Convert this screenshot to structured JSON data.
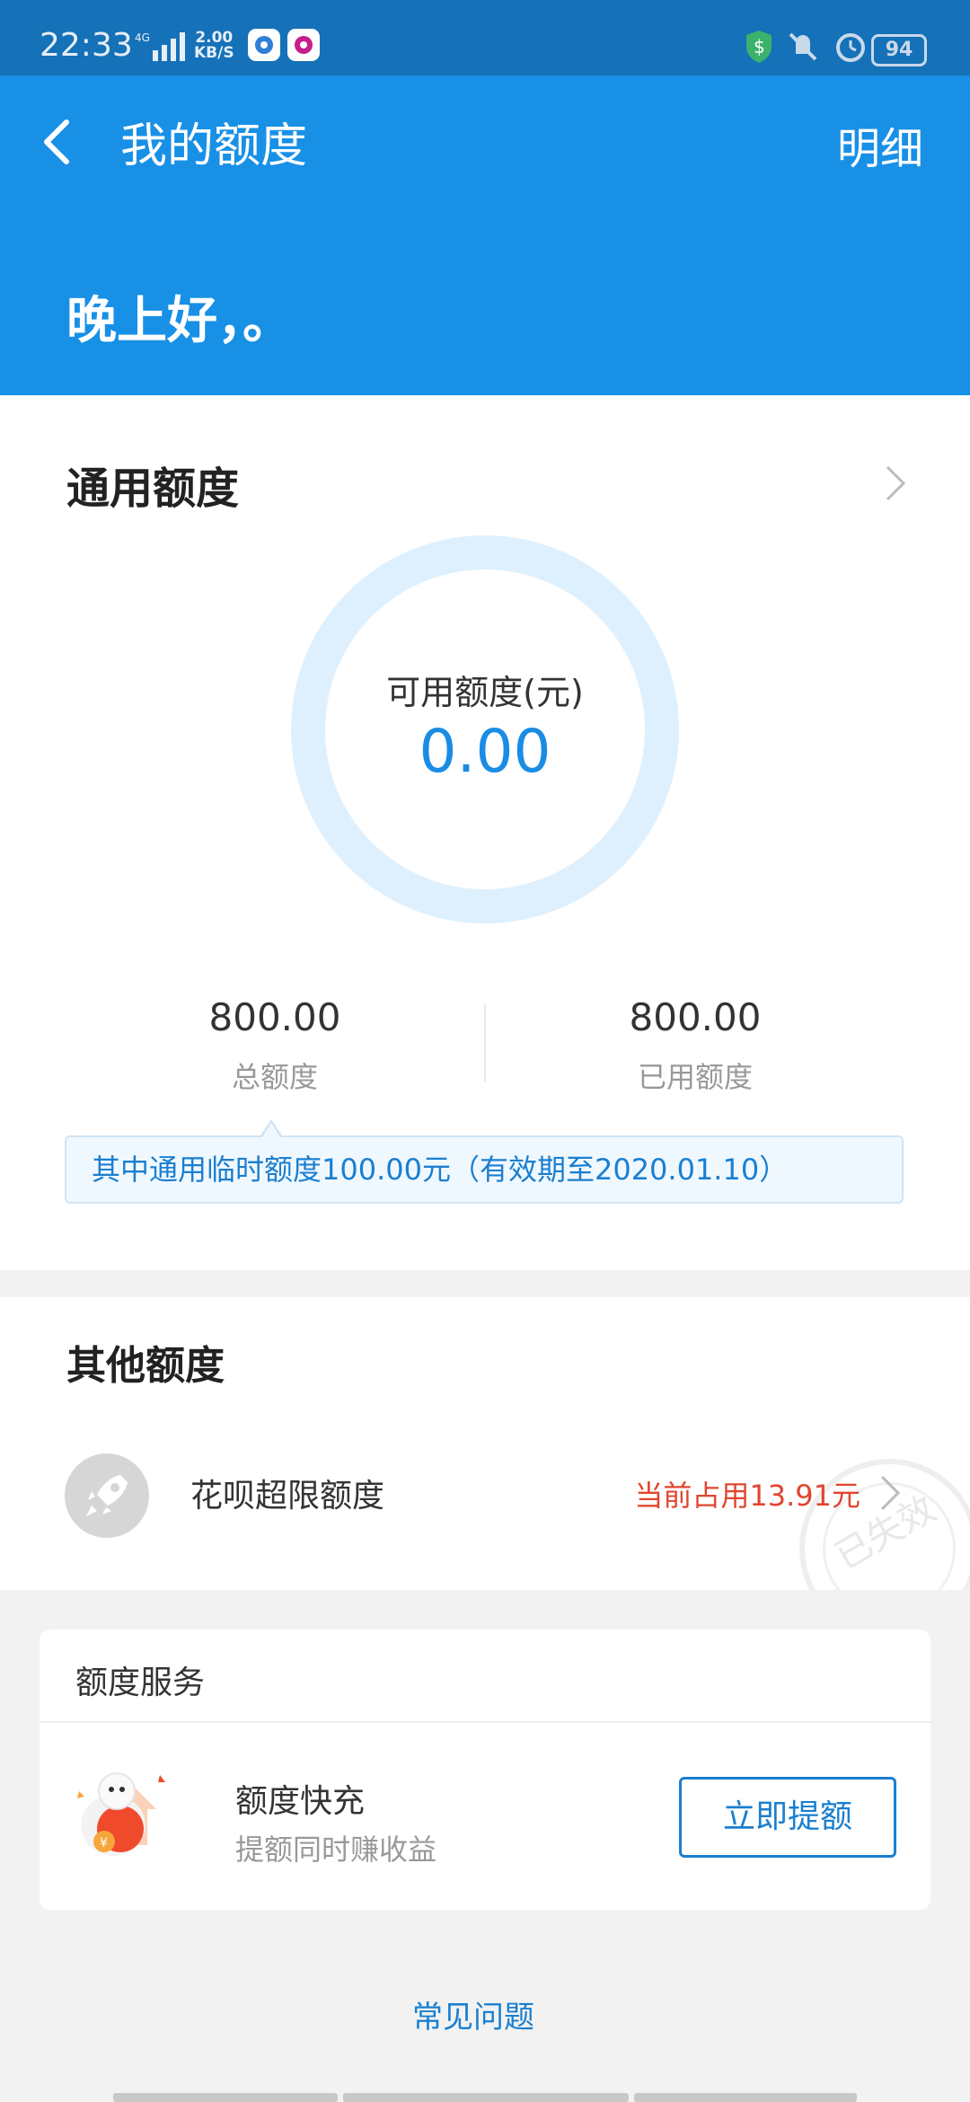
{
  "status_bar": {
    "time": "22:33",
    "network": "4G",
    "speed_value": "2.00",
    "speed_unit": "KB/S",
    "battery": "94"
  },
  "header": {
    "title": "我的额度",
    "detail_label": "明细",
    "greeting": "晚上好，。"
  },
  "general_quota": {
    "title": "通用额度",
    "available_label": "可用额度(元)",
    "available_value": "0.00",
    "total_value": "800.00",
    "total_label": "总额度",
    "used_value": "800.00",
    "used_label": "已用额度",
    "notice": "其中通用临时额度100.00元（有效期至2020.01.10）"
  },
  "other_quota": {
    "title": "其他额度",
    "item_name": "花呗超限额度",
    "item_status": "当前占用13.91元",
    "stamp_text": "已失效"
  },
  "service": {
    "title": "额度服务",
    "item_name": "额度快充",
    "item_subtitle": "提额同时赚收益",
    "button_label": "立即提额"
  },
  "faq_label": "常见问题",
  "colors": {
    "brand_blue": "#1890e6",
    "status_bar": "#1571b8",
    "link_blue": "#1a7fd0",
    "warning_red": "#e0452f",
    "ring": "#def0fd"
  }
}
